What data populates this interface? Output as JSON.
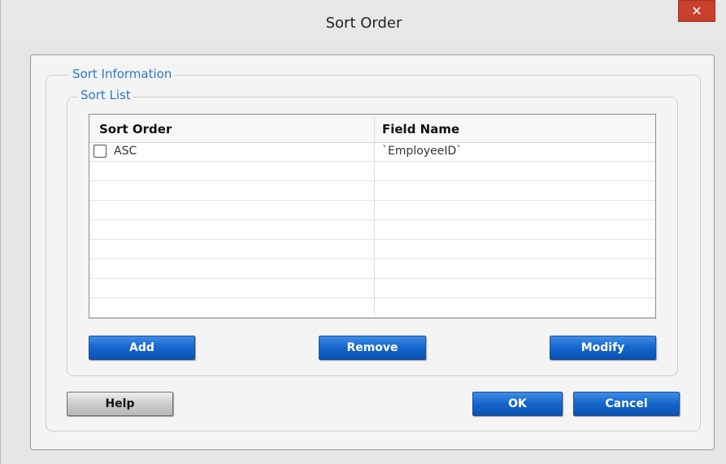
{
  "window": {
    "title": "Sort Order",
    "close_glyph": "✕"
  },
  "groups": {
    "outer_label": "Sort Information",
    "inner_label": "Sort List"
  },
  "grid": {
    "columns": [
      "Sort Order",
      "Field Name"
    ],
    "rows": [
      {
        "sort_order": "ASC",
        "field_name": "`EmployeeID`",
        "checked": false
      }
    ]
  },
  "list_buttons": {
    "add": "Add",
    "remove": "Remove",
    "modify": "Modify"
  },
  "dialog_buttons": {
    "help": "Help",
    "ok": "OK",
    "cancel": "Cancel"
  },
  "colors": {
    "accent_blue": "#1465cc",
    "legend_blue": "#2a77c9",
    "close_red": "#c9402f"
  }
}
